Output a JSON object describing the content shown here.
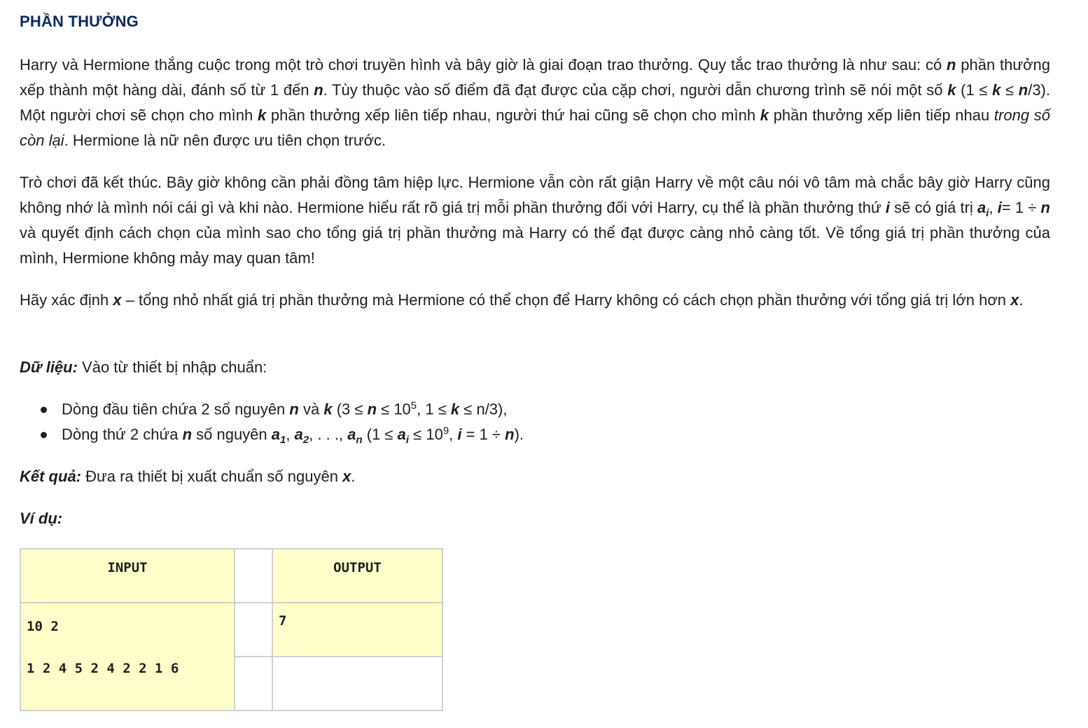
{
  "title": "PHẦN THƯỞNG",
  "p1": {
    "t1": "Harry và Hermione thắng cuộc trong một trò chơi truyền hình và bây giờ là giai đoạn trao thưởng. Quy tắc trao thưởng là như sau: có ",
    "v1": "n",
    "t2": " phần thưởng xếp thành một hàng dài, đánh số từ 1 đến ",
    "v2": "n",
    "t3": ". Tùy thuộc vào số điểm đã đạt được của cặp chơi, người dẫn chương trình sẽ nói một số ",
    "v3": "k",
    "t4": " (1 ≤ ",
    "v4": "k",
    "t5": " ≤ ",
    "v5": "n",
    "t6": "/3). Một người chơi sẽ chọn cho mình ",
    "v6": "k",
    "t7": " phần thưởng xếp liên tiếp nhau, người thứ hai cũng sẽ chọn cho mình ",
    "v7": "k",
    "t8": " phần thưởng xếp liên tiếp nhau ",
    "em": "trong số còn lại",
    "t9": ". Hermione là nữ nên được ưu tiên chọn trước."
  },
  "p2": {
    "t1": "Trò chơi đã kết thúc. Bây giờ không cần phải đồng tâm hiệp lực. Hermione vẫn còn rất giận Harry về một câu nói vô tâm mà chắc bây giờ Harry cũng không nhớ là mình nói cái gì và khi nào. Hermione hiểu rất rõ giá trị mỗi phần thưởng đối với Harry, cụ thể là phần thưởng thứ ",
    "v1": "i",
    "t2": " sẽ có giá trị ",
    "v2": "a",
    "s2": "i",
    "t3": ", ",
    "v3": "i",
    "t4": "= 1 ÷ ",
    "v4": "n",
    "t5": " và quyết định cách chọn của mình sao cho tổng giá trị phần thưởng mà Harry có thể đạt được càng nhỏ càng tốt. Về tổng giá trị phần thưởng của mình, Hermione không mảy may quan tâm!"
  },
  "p3": {
    "t1": "Hãy xác định ",
    "v1": "x",
    "t2": " – tổng nhỏ nhất giá trị phần thưởng mà Hermione có thể chọn để Harry không có cách chọn phần thưởng với tổng giá trị lớn hơn ",
    "v2": "x",
    "t3": "."
  },
  "p4": {
    "label": "Dữ liệu:",
    "text": " Vào từ thiết bị nhập chuẩn:"
  },
  "list": {
    "item1": {
      "t1": "Dòng đầu tiên chứa 2 số nguyên ",
      "v1": "n",
      "t2": " và ",
      "v2": "k",
      "t3": " (3 ≤ ",
      "v3": "n",
      "t4": " ≤ 10",
      "sup": "5",
      "t5": ", 1 ≤ ",
      "v5": "k",
      "t6": " ≤ n/3),"
    },
    "item2": {
      "t1": "Dòng thứ 2 chứa ",
      "v1": "n",
      "t2": " số nguyên ",
      "a1": "a",
      "s1": "1",
      "c1": ", ",
      "a2": "a",
      "s2": "2",
      "c2": ", . . ., ",
      "an": "a",
      "sn": "n",
      "t3": " (1 ≤ ",
      "ai": "a",
      "si": "i",
      "t4": " ≤ 10",
      "sup": "9",
      "t5": ", ",
      "vi": "i",
      "t6": " = 1 ÷ ",
      "vn": "n",
      "t7": ")."
    }
  },
  "p5": {
    "label": "Kết quả:",
    "text": " Đưa ra thiết bị xuất chuẩn số nguyên ",
    "v1": "x",
    "t2": "."
  },
  "p6": {
    "label": "Ví dụ:"
  },
  "example": {
    "input_header": "INPUT",
    "output_header": "OUTPUT",
    "input_lines": [
      "10 2",
      "1 2 4 5 2 4 2 2 1 6"
    ],
    "output_lines": [
      "7"
    ]
  }
}
